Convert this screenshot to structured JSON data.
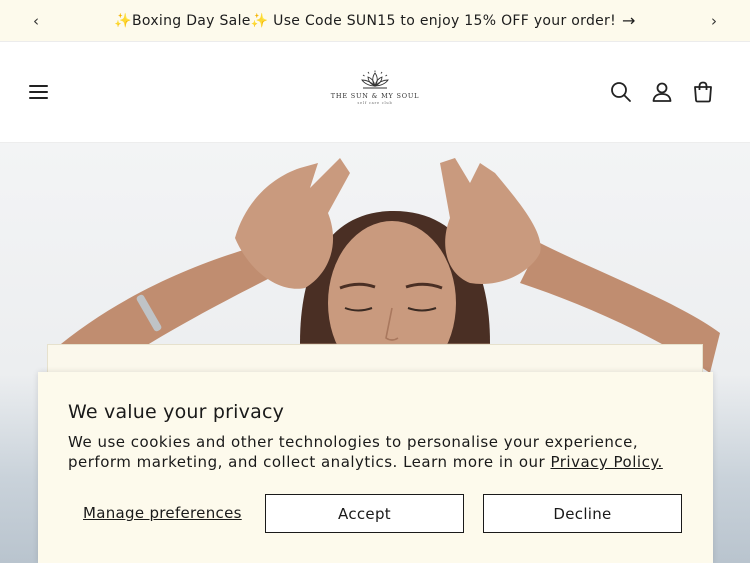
{
  "announcement": {
    "text": "✨Boxing Day Sale✨ Use Code SUN15 to enjoy 15% OFF your order!",
    "arrow": "→",
    "prev": "‹",
    "next": "›"
  },
  "header": {
    "logo_text": "THE SUN & MY SOUL",
    "logo_subtext": "self care club",
    "icons": [
      "menu-icon",
      "search-icon",
      "account-icon",
      "cart-icon"
    ]
  },
  "cookie_banner": {
    "title": "We value your privacy",
    "body": "We use cookies and other technologies to personalise your experience, perform marketing, and collect analytics. Learn more in our ",
    "link_label": "Privacy Policy.",
    "manage_label": "Manage preferences",
    "accept_label": "Accept",
    "decline_label": "Decline"
  },
  "colors": {
    "announcement_bg": "#fdfaec",
    "banner_bg": "#fdfaec",
    "text": "#1a1a1a"
  }
}
